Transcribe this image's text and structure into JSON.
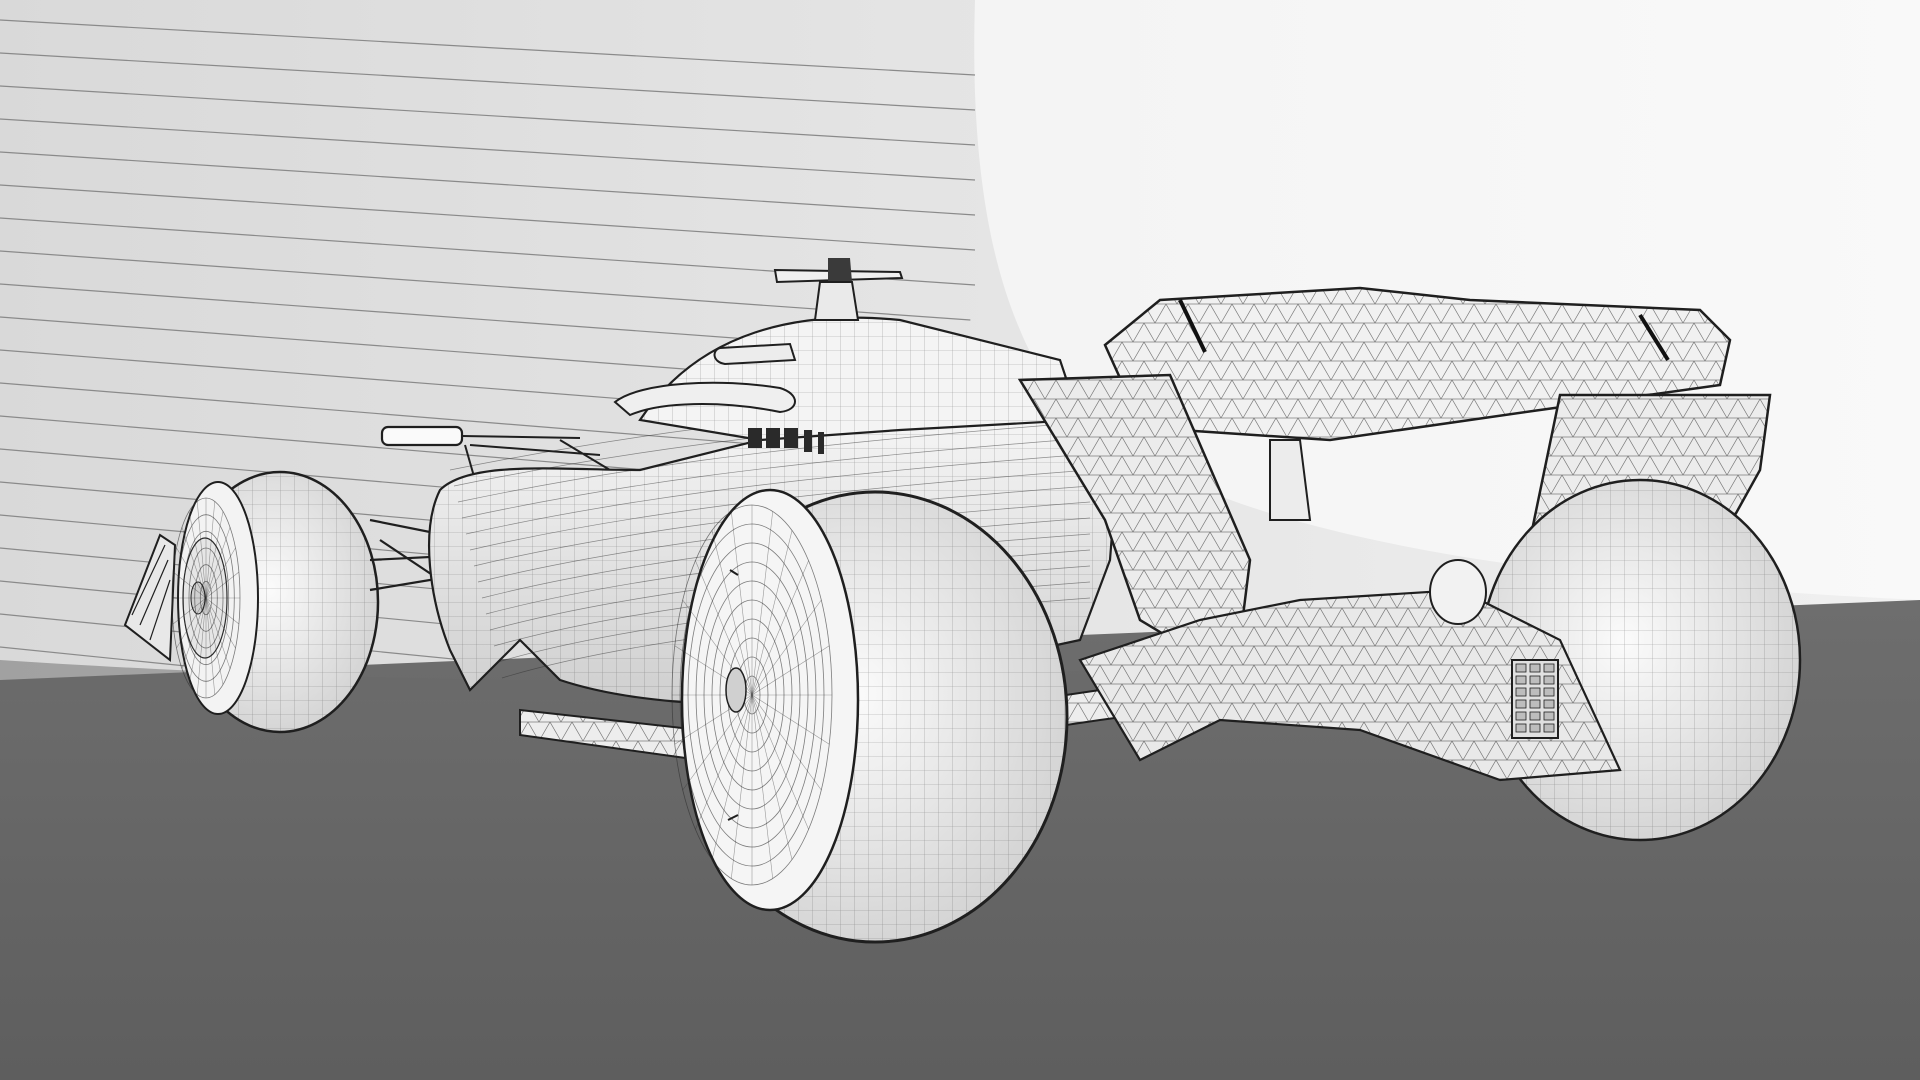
{
  "scene": {
    "subject": "race-car-wireframe-render",
    "colors": {
      "floor": "#666666",
      "backdrop_left": "#e6e6e6",
      "backdrop_right": "#f2f2f2",
      "stripe_line": "#8a8a8a",
      "body_fill": "#f2f2f2",
      "mesh_line": "#2b2b2b",
      "outline": "#1f1f1f"
    }
  }
}
